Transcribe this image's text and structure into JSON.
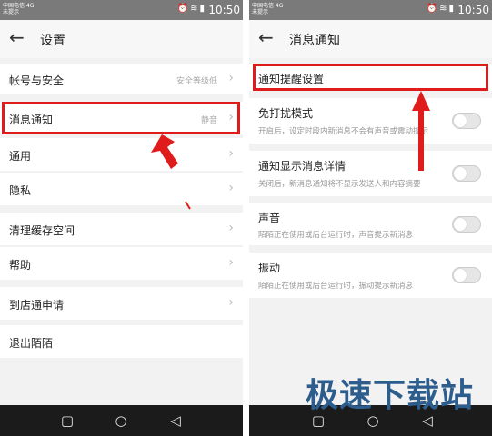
{
  "left": {
    "status": {
      "carrier_line1": "中国电信 4G",
      "carrier_line2": "未提示",
      "time": "10:50"
    },
    "title": "设置",
    "items": [
      {
        "label": "帐号与安全",
        "value": "安全等级低"
      },
      {
        "label": "消息通知",
        "value": "静音"
      },
      {
        "label": "通用",
        "value": ""
      },
      {
        "label": "隐私",
        "value": ""
      },
      {
        "label": "清理缓存空间",
        "value": ""
      },
      {
        "label": "帮助",
        "value": ""
      },
      {
        "label": "到店通申请",
        "value": ""
      },
      {
        "label": "退出陌陌",
        "value": ""
      }
    ]
  },
  "right": {
    "status": {
      "carrier_line1": "中国电信 4G",
      "carrier_line2": "未提示",
      "time": "10:50"
    },
    "title": "消息通知",
    "items": [
      {
        "label": "通知提醒设置",
        "desc": ""
      },
      {
        "label": "免打扰模式",
        "desc": "开启后，设定时段内新消息不会有声音或震动提示"
      },
      {
        "label": "通知显示消息详情",
        "desc": "关闭后，新消息通知将不显示发送人和内容摘要"
      },
      {
        "label": "声音",
        "desc": "陌陌正在使用或后台运行时，声音提示新消息"
      },
      {
        "label": "振动",
        "desc": "陌陌正在使用或后台运行时，振动提示新消息"
      }
    ]
  },
  "icons": {
    "back": "arrow-left-icon",
    "chevron": "chevron-right-icon",
    "nav_square": "square-icon",
    "nav_circle": "circle-icon",
    "nav_back": "triangle-back-icon"
  },
  "colors": {
    "highlight": "#e01b1b",
    "watermark": "#2d5d8c"
  },
  "watermark": "极速下载站"
}
